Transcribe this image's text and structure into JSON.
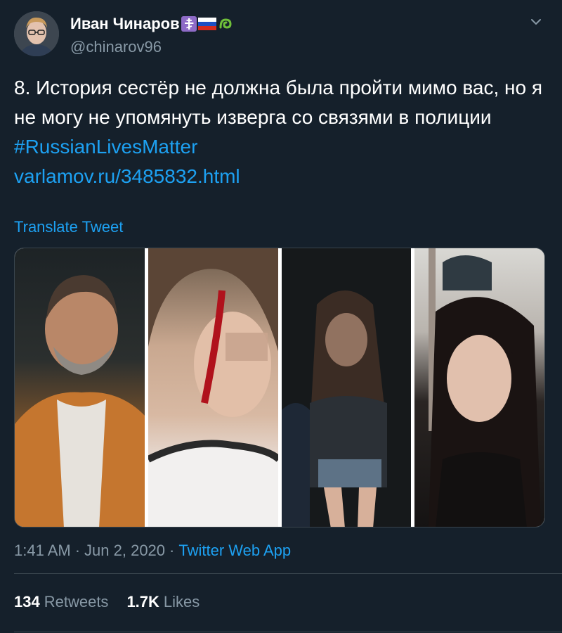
{
  "author": {
    "name": "Иван Чинаров",
    "handle": "@chinarov96",
    "badges": [
      "orthodox-cross-icon",
      "russia-flag-icon",
      "green-swirl-icon"
    ]
  },
  "tweet": {
    "text": "8. История сестёр не должна была пройти мимо вас, но я не могу не упомянуть изверга со связями в полиции",
    "hashtag": "#RussianLivesMatter",
    "link": "varlamov.ru/3485832.html",
    "translate_label": "Translate Tweet"
  },
  "media": {
    "panels": [
      "photo-man-portrait",
      "photo-injured-girl",
      "photo-girl-handcuffed",
      "photo-girl-courtroom"
    ]
  },
  "meta": {
    "time": "1:41 AM",
    "sep1": "·",
    "date": "Jun 2, 2020",
    "sep2": "·",
    "source": "Twitter Web App"
  },
  "stats": {
    "retweets_count": "134",
    "retweets_label": "Retweets",
    "likes_count": "1.7K",
    "likes_label": "Likes"
  },
  "colors": {
    "background": "#15202b",
    "link": "#1da1f2",
    "secondary_text": "#8899a6",
    "divider": "#38444d"
  }
}
